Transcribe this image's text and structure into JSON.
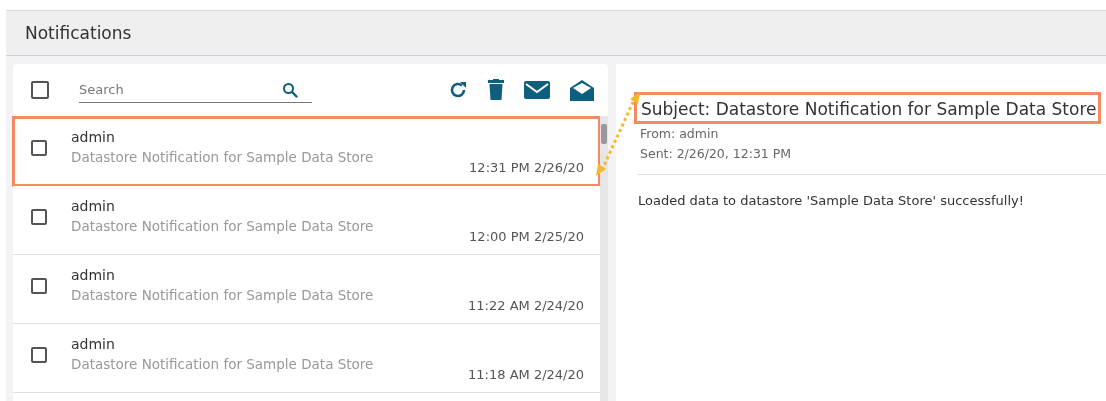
{
  "header": {
    "title": "Notifications"
  },
  "toolbar": {
    "select_all": {
      "checked": false
    },
    "search": {
      "placeholder": "Search"
    }
  },
  "messages": [
    {
      "sender": "admin",
      "subject": "Datastore Notification for Sample Data Store",
      "time": "12:31 PM 2/26/20",
      "checked": false,
      "highlighted": true
    },
    {
      "sender": "admin",
      "subject": "Datastore Notification for Sample Data Store",
      "time": "12:00 PM 2/25/20",
      "checked": false,
      "highlighted": false
    },
    {
      "sender": "admin",
      "subject": "Datastore Notification for Sample Data Store",
      "time": "11:22 AM 2/24/20",
      "checked": false,
      "highlighted": false
    },
    {
      "sender": "admin",
      "subject": "Datastore Notification for Sample Data Store",
      "time": "11:18 AM 2/24/20",
      "checked": false,
      "highlighted": false
    }
  ],
  "detail": {
    "subject": "Subject: Datastore Notification for Sample Data Store",
    "subject_highlighted": true,
    "from": "From: admin",
    "sent": "Sent: 2/26/20, 12:31 PM",
    "body": "Loaded data to datastore 'Sample Data Store' successfully!"
  }
}
